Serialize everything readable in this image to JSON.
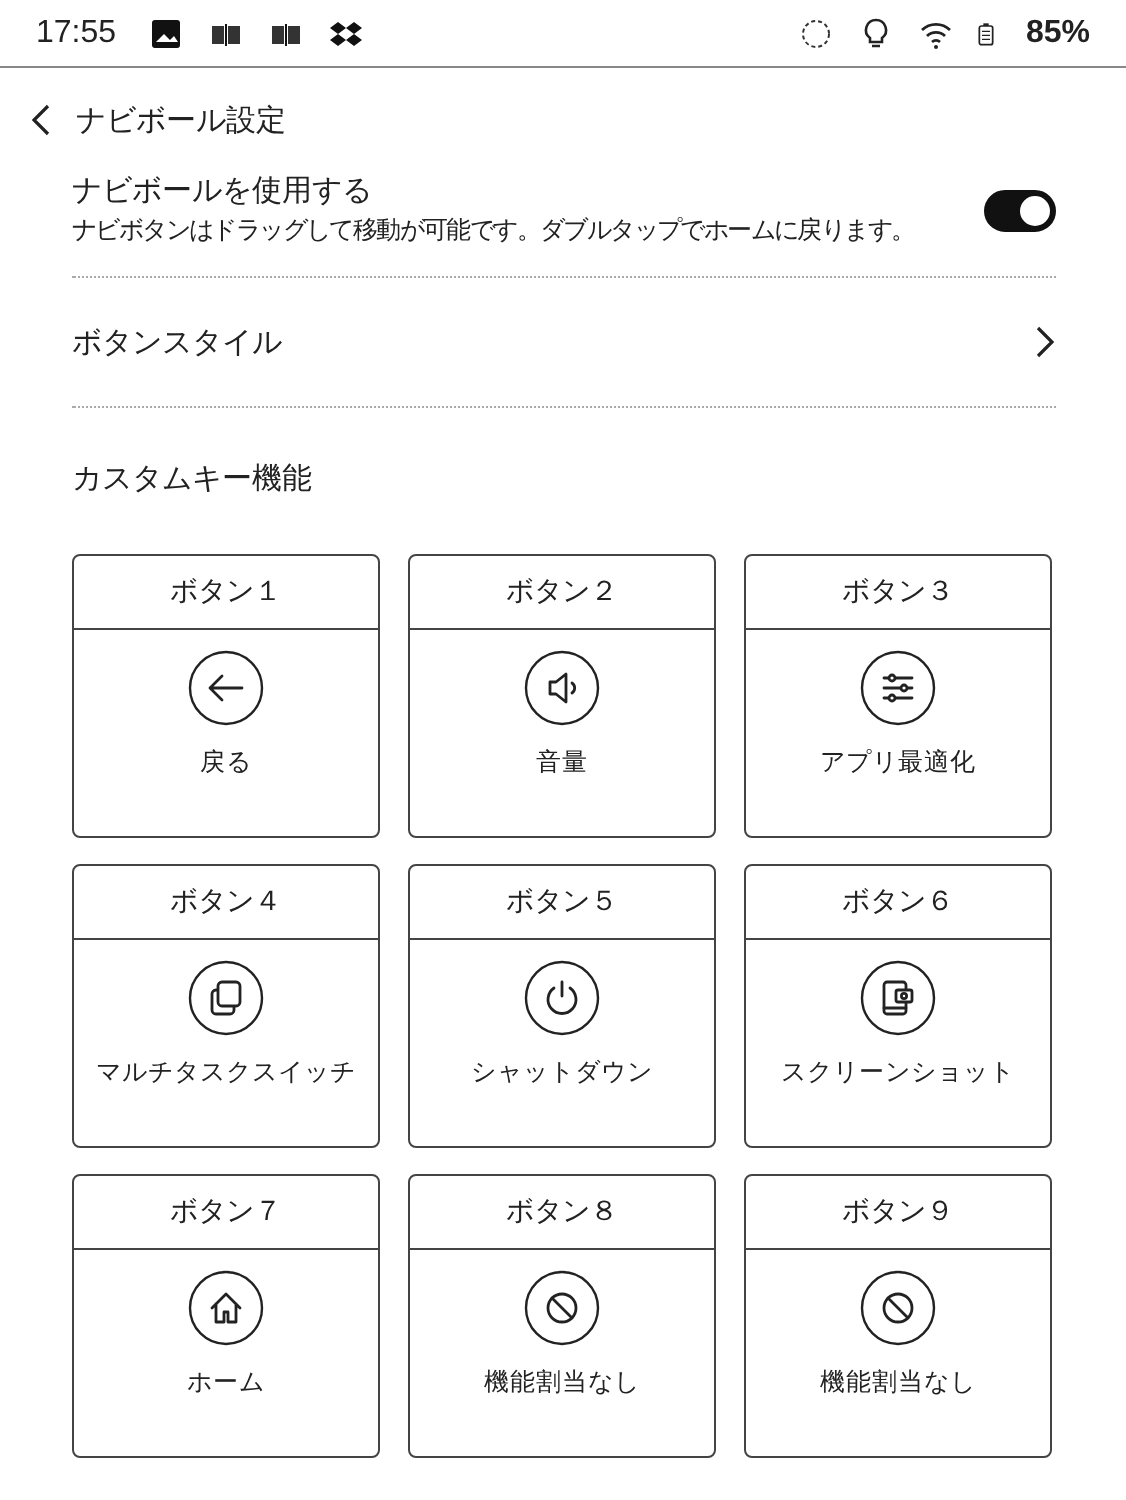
{
  "status_bar": {
    "time": "17:55",
    "battery": "85%"
  },
  "header": {
    "title": "ナビボール設定"
  },
  "toggle_row": {
    "title": "ナビボールを使用する",
    "description": "ナビボタンはドラッグして移動が可能です。ダブルタップでホームに戻ります。",
    "on": true
  },
  "nav_row": {
    "title": "ボタンスタイル"
  },
  "section": {
    "title": "カスタムキー機能"
  },
  "keys": [
    {
      "title": "ボタン１",
      "kind": "back",
      "label": "戻る"
    },
    {
      "title": "ボタン２",
      "kind": "volume",
      "label": "音量"
    },
    {
      "title": "ボタン３",
      "kind": "optimize",
      "label": "アプリ最適化"
    },
    {
      "title": "ボタン４",
      "kind": "multitask",
      "label": "マルチタスクスイッチ"
    },
    {
      "title": "ボタン５",
      "kind": "power",
      "label": "シャットダウン"
    },
    {
      "title": "ボタン６",
      "kind": "screenshot",
      "label": "スクリーンショット"
    },
    {
      "title": "ボタン７",
      "kind": "home",
      "label": "ホーム"
    },
    {
      "title": "ボタン８",
      "kind": "none",
      "label": "機能割当なし"
    },
    {
      "title": "ボタン９",
      "kind": "none",
      "label": "機能割当なし"
    }
  ]
}
